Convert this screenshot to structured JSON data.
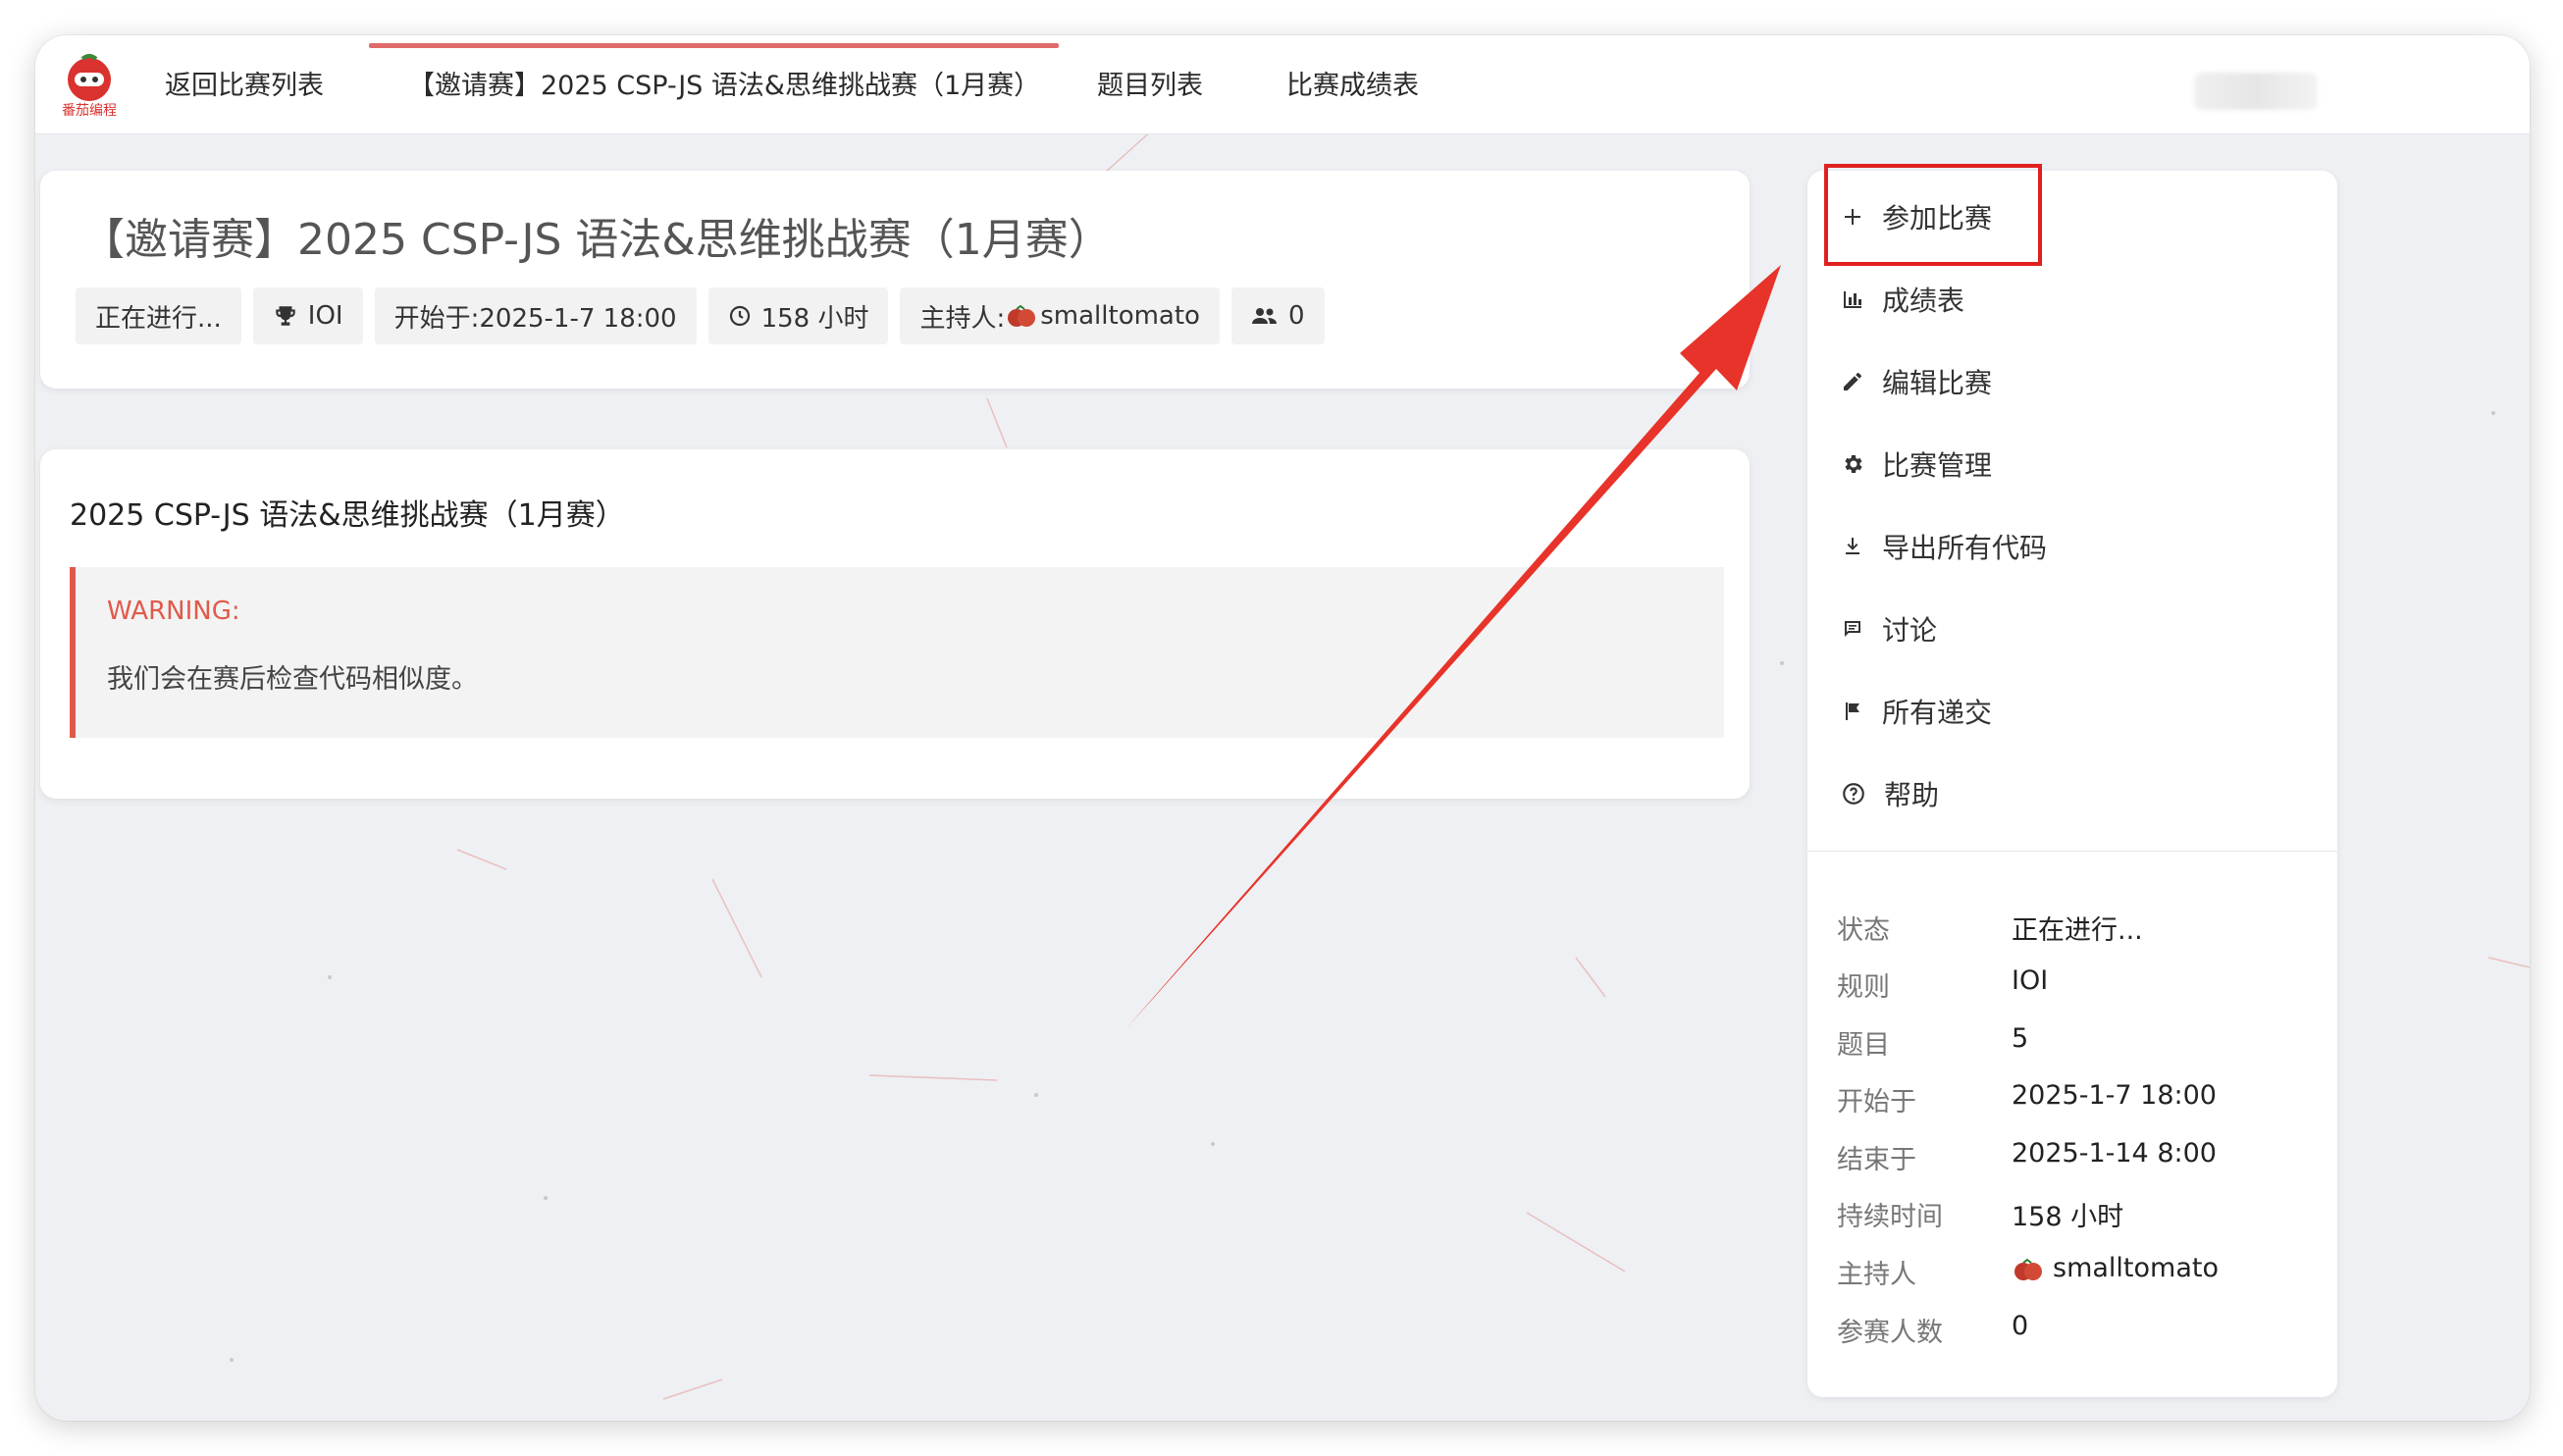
{
  "logo": {
    "text": "番茄编程",
    "color": "#d9322f"
  },
  "nav": {
    "back": "返回比赛列表",
    "active_tab": "【邀请赛】2025 CSP-JS 语法&思维挑战赛（1月赛）",
    "problems": "题目列表",
    "scoreboard": "比赛成绩表"
  },
  "contest": {
    "title": "【邀请赛】2025 CSP-JS 语法&思维挑战赛（1月赛）",
    "tags": {
      "status": "正在进行...",
      "rule": "IOI",
      "start": "开始于:2025-1-7 18:00",
      "duration": "158 小时",
      "host_prefix": "主持人:",
      "host": "smalltomato",
      "participants": "0"
    }
  },
  "description": {
    "title": "2025 CSP-JS 语法&思维挑战赛（1月赛）",
    "warning_label": "WARNING:",
    "warning_text": "我们会在赛后检查代码相似度。"
  },
  "menu": {
    "join": "参加比赛",
    "scoreboard": "成绩表",
    "edit": "编辑比赛",
    "manage": "比赛管理",
    "export": "导出所有代码",
    "discuss": "讨论",
    "submissions": "所有递交",
    "help": "帮助"
  },
  "info": {
    "status_label": "状态",
    "status": "正在进行...",
    "rule_label": "规则",
    "rule": "IOI",
    "problems_label": "题目",
    "problems": "5",
    "start_label": "开始于",
    "start": "2025-1-7 18:00",
    "end_label": "结束于",
    "end": "2025-1-14 8:00",
    "duration_label": "持续时间",
    "duration": "158 小时",
    "host_label": "主持人",
    "host": "smalltomato",
    "participants_label": "参赛人数",
    "participants": "0"
  },
  "colors": {
    "accent_red": "#e02020",
    "warning": "#e05a4a",
    "tab_underline": "#e06a6a"
  }
}
